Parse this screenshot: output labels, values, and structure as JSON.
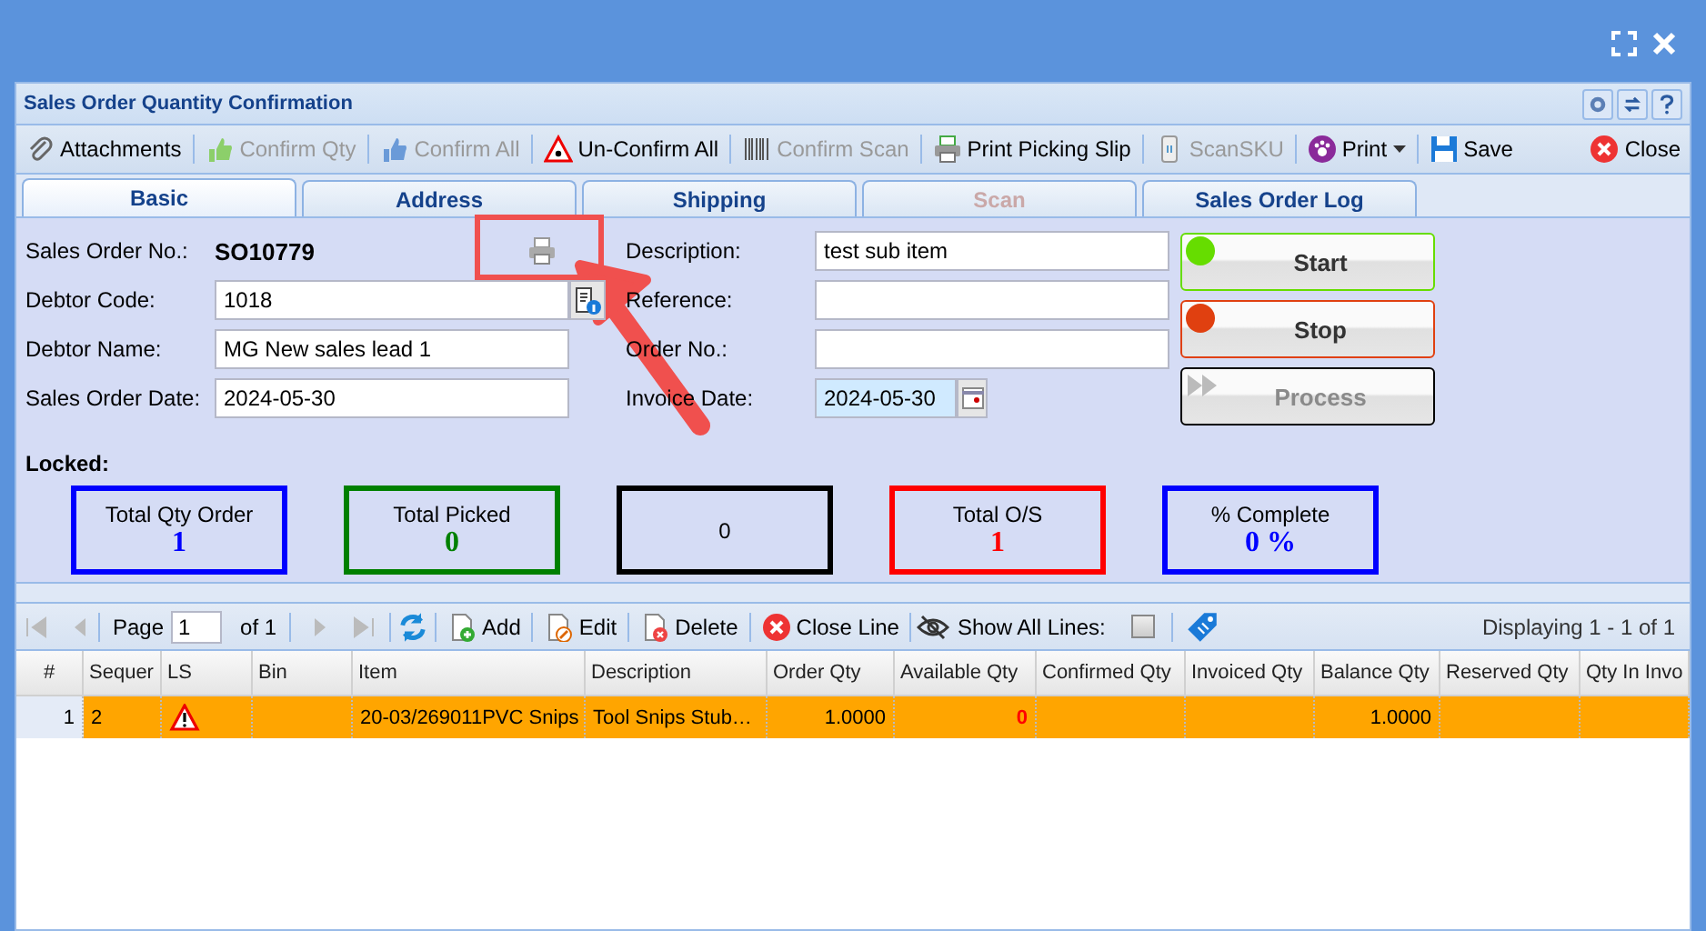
{
  "window": {
    "title": "Sales Order Quantity Confirmation"
  },
  "toolbar": [
    {
      "label": "Attachments",
      "kind": "clip",
      "disabled": false
    },
    {
      "label": "Confirm Qty",
      "kind": "thumb-light",
      "disabled": true
    },
    {
      "label": "Confirm All",
      "kind": "thumb",
      "disabled": true
    },
    {
      "label": "Un-Confirm All",
      "kind": "warn",
      "disabled": false
    },
    {
      "label": "Confirm Scan",
      "kind": "barcode",
      "disabled": true
    },
    {
      "label": "Print Picking Slip",
      "kind": "printer",
      "disabled": false
    },
    {
      "label": "ScanSKU",
      "kind": "phone",
      "disabled": true
    },
    {
      "label": "Print",
      "kind": "menu",
      "disabled": false
    },
    {
      "label": "Save",
      "kind": "disk",
      "disabled": false
    },
    {
      "label": "Close",
      "kind": "close",
      "disabled": false
    }
  ],
  "tabs": [
    {
      "label": "Basic",
      "selected": true,
      "disabled": false
    },
    {
      "label": "Address",
      "selected": false,
      "disabled": false
    },
    {
      "label": "Shipping",
      "selected": false,
      "disabled": false
    },
    {
      "label": "Scan",
      "selected": false,
      "disabled": true
    },
    {
      "label": "Sales Order Log",
      "selected": false,
      "disabled": false
    }
  ],
  "form": {
    "sales_order_no": {
      "label": "Sales Order No.:",
      "value": "SO10779"
    },
    "debtor_code": {
      "label": "Debtor Code:",
      "value": "1018"
    },
    "debtor_name": {
      "label": "Debtor Name:",
      "value": "MG New sales lead 1"
    },
    "sales_order_date": {
      "label": "Sales Order Date:",
      "value": "2024-05-30"
    },
    "description": {
      "label": "Description:",
      "value": "test sub item"
    },
    "reference": {
      "label": "Reference:"
    },
    "order_no": {
      "label": "Order No.:"
    },
    "invoice_date": {
      "label": "Invoice Date:",
      "value": "2024-05-30"
    },
    "locked": {
      "label": "Locked:"
    }
  },
  "actions": [
    {
      "label": "Start",
      "color": "#66dd00",
      "disabled": false
    },
    {
      "label": "Stop",
      "color": "#e04010",
      "disabled": false
    },
    {
      "label": "Process",
      "color": "#000000",
      "disabled": true
    }
  ],
  "stats": [
    {
      "label": "Total Qty Order",
      "value": "1",
      "color": "#0000ff"
    },
    {
      "label": "Total Picked",
      "value": "0",
      "color": "#008000"
    },
    {
      "label": "0",
      "color": "#000000"
    },
    {
      "label": "Total O/S",
      "value": "1",
      "color": "#ff0000"
    },
    {
      "label": "% Complete",
      "value": "0 %",
      "color": "#0000ff"
    }
  ],
  "pager": {
    "page_label": "Page",
    "page": "1",
    "of": "of 1",
    "buttons": [
      {
        "label": "Add",
        "kind": "add"
      },
      {
        "label": "Edit",
        "kind": "edit"
      },
      {
        "label": "Delete",
        "kind": "delete"
      },
      {
        "label": "Close Line",
        "kind": "close"
      }
    ],
    "show_all_lines": {
      "label": "Show All Lines:",
      "checked": false
    },
    "display_info": "Displaying 1 - 1 of 1"
  },
  "table": {
    "columns": [
      "#",
      "Sequer",
      "LS",
      "Bin",
      "Item",
      "Description",
      "Order Qty",
      "Available Qty",
      "Confirmed Qty",
      "Invoiced Qty",
      "Balance Qty",
      "Reserved Qty",
      "Qty In Invo"
    ],
    "rows": [
      {
        "highlighted": true,
        "warning": true,
        "stock_short": true,
        "cells": [
          "1",
          "2",
          "",
          "",
          "20-03/269011PVC Snips",
          "Tool Snips Stub…",
          "1.0000",
          "0",
          "",
          "",
          "1.0000",
          "",
          ""
        ]
      }
    ]
  }
}
